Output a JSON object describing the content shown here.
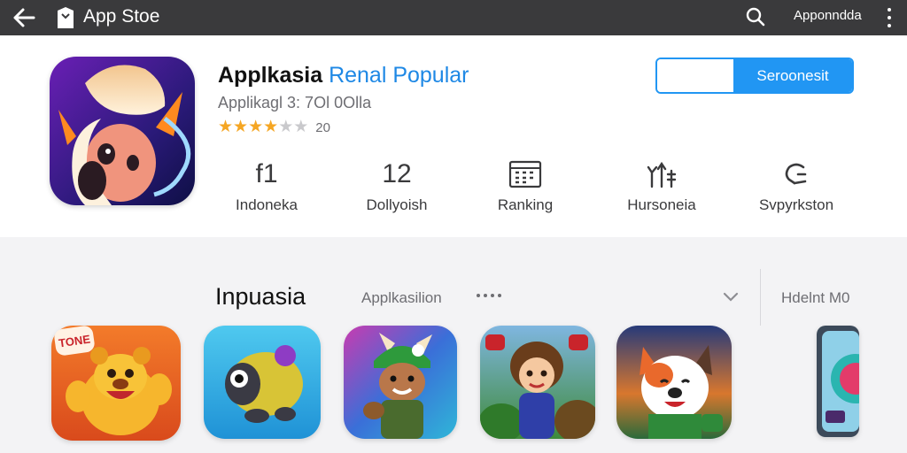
{
  "topbar": {
    "title": "App Stoe",
    "link": "Apponndda"
  },
  "app": {
    "title_main": "Applkasia",
    "title_accent": "Renal Popular",
    "subtitle": "Applikagl 3: 7Ol 0Olla",
    "rating_value": 3.5,
    "rating_count": "20"
  },
  "actions": {
    "primary_label": "Seroonesit"
  },
  "stats": [
    {
      "value": "f1",
      "label": "Indoneka"
    },
    {
      "value": "12",
      "label": "Dollyoish"
    },
    {
      "value": "",
      "icon": "calendar-grid-icon",
      "label": "Ranking"
    },
    {
      "value": "",
      "icon": "wrench-tools-icon",
      "label": "Hursoneia"
    },
    {
      "value": "",
      "icon": "refresh-arrow-icon",
      "label": "Svpyrkston"
    }
  ],
  "section": {
    "title": "Inpuasia",
    "subtitle": "Applkasilion",
    "right_label": "Hdelnt M0"
  },
  "apps": [
    {
      "icon": "bear-game-icon",
      "badge": "TONE",
      "label": ""
    },
    {
      "icon": "creature-game-icon",
      "label": ""
    },
    {
      "icon": "hero-cap-game-icon",
      "label": ""
    },
    {
      "icon": "girl-adventure-game-icon",
      "label": ""
    },
    {
      "icon": "dog-face-game-icon",
      "label": ""
    },
    {
      "icon": "partial-app-icon",
      "label": ""
    }
  ],
  "colors": {
    "topbar": "#3a3a3c",
    "accent": "#2196f3",
    "star": "#f5a623"
  }
}
